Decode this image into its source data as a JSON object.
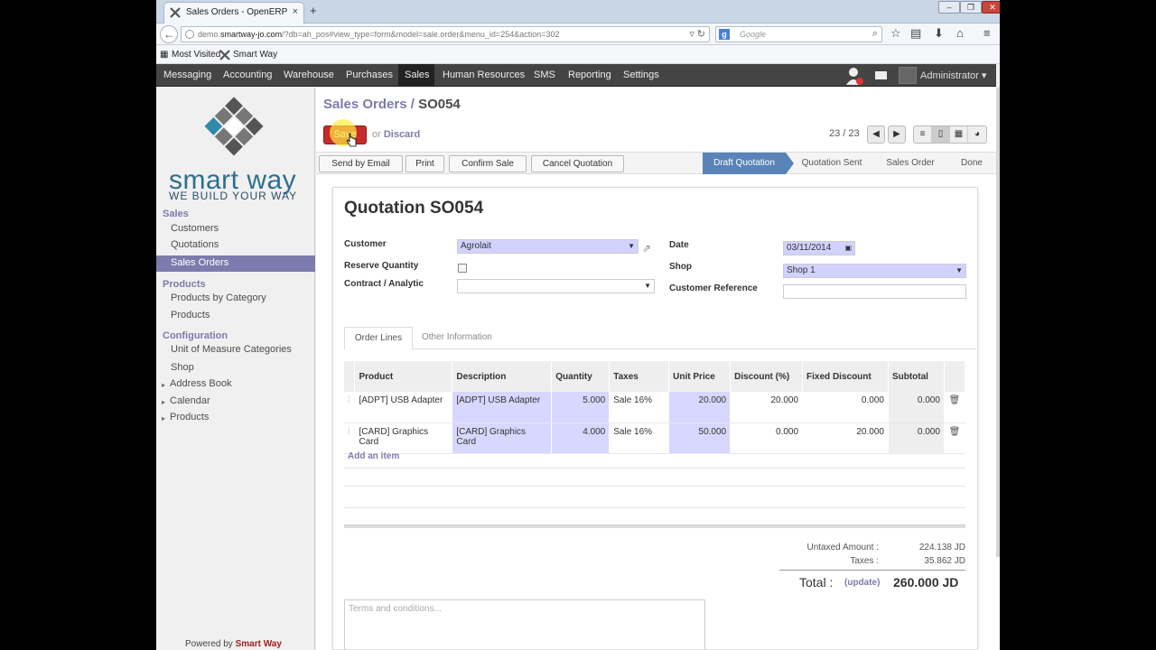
{
  "browser": {
    "tab_title": "Sales Orders - OpenERP",
    "tab_close": "×",
    "new_tab": "+",
    "url_prefix": "demo.",
    "url_host": "smartway-jo.com",
    "url_rest": "/?db=ah_pos#view_type=form&model=sale.order&menu_id=254&action=302",
    "search_placeholder": "Google",
    "bookmarks": [
      "Most Visited",
      "Smart Way"
    ]
  },
  "topmenu": {
    "items": [
      "Messaging",
      "Accounting",
      "Warehouse",
      "Purchases",
      "Sales",
      "Human Resources",
      "SMS",
      "Reporting",
      "Settings"
    ],
    "user": "Administrator"
  },
  "sidebar": {
    "brand": "smart way",
    "tagline": "WE BUILD YOUR WAY",
    "sections": [
      {
        "title": "Sales",
        "items": [
          "Customers",
          "Quotations",
          "Sales Orders"
        ]
      },
      {
        "title": "Products",
        "items": [
          "Products by Category",
          "Products"
        ]
      },
      {
        "title": "Configuration",
        "items": [
          "Unit of Measure Categories",
          "Shop"
        ]
      }
    ],
    "collapsed": [
      "Address Book",
      "Calendar",
      "Products"
    ],
    "powered_prefix": "Powered by",
    "powered_brand": "Smart Way",
    "selected": "Sales Orders"
  },
  "form": {
    "breadcrumb_parent": "Sales Orders",
    "breadcrumb_sep": "/",
    "breadcrumb_current": "SO054",
    "save_label": "Save",
    "or_label": "or",
    "discard_label": "Discard",
    "pager": "23 / 23",
    "actions": [
      "Send by Email",
      "Print",
      "Confirm Sale",
      "Cancel Quotation"
    ],
    "states": [
      "Draft Quotation",
      "Quotation Sent",
      "Sales Order",
      "Done"
    ],
    "active_state": "Draft Quotation",
    "title_prefix": "Quotation",
    "title_ref": "SO054",
    "fields": {
      "customer_label": "Customer",
      "customer_value": "Agrolait",
      "reserve_label": "Reserve Quantity",
      "reserve_checked": false,
      "contract_label": "Contract / Analytic",
      "contract_value": "",
      "date_label": "Date",
      "date_value": "03/11/2014",
      "shop_label": "Shop",
      "shop_value": "Shop 1",
      "custref_label": "Customer Reference",
      "custref_value": ""
    },
    "tabs": [
      "Order Lines",
      "Other Information"
    ],
    "lines_columns": [
      "Product",
      "Description",
      "Quantity",
      "Taxes",
      "Unit Price",
      "Discount (%)",
      "Fixed Discount",
      "Subtotal"
    ],
    "lines": [
      {
        "product": "[ADPT] USB Adapter",
        "description": "[ADPT] USB Adapter",
        "quantity": "5.000",
        "taxes": "Sale 16%",
        "unit_price": "20.000",
        "discount": "20.000",
        "fixed_discount": "0.000",
        "subtotal": "0.000"
      },
      {
        "product": "[CARD] Graphics Card",
        "description": "[CARD] Graphics Card",
        "quantity": "4.000",
        "taxes": "Sale 16%",
        "unit_price": "50.000",
        "discount": "0.000",
        "fixed_discount": "20.000",
        "subtotal": "0.000"
      }
    ],
    "add_item": "Add an item",
    "untaxed_label": "Untaxed Amount :",
    "untaxed_value": "224.138 JD",
    "taxes_label": "Taxes :",
    "taxes_value": "35.862 JD",
    "total_label": "Total :",
    "update_label": "(update)",
    "total_value": "260.000 JD",
    "terms_placeholder": "Terms and conditions..."
  },
  "colors": {
    "accent": "#7c7bad",
    "save": "#c52b2b",
    "required_field": "#d2d2ff",
    "active_state": "#5a84b8"
  }
}
